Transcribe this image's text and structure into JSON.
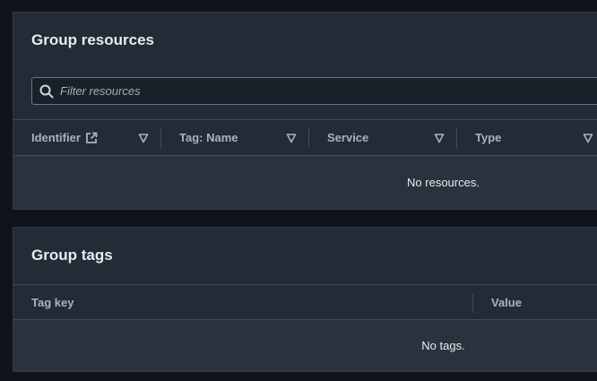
{
  "resources": {
    "title": "Group resources",
    "filter_placeholder": "Filter resources",
    "columns": [
      {
        "label": "Identifier"
      },
      {
        "label": "Tag: Name"
      },
      {
        "label": "Service"
      },
      {
        "label": "Type"
      }
    ],
    "empty_text": "No resources."
  },
  "tags": {
    "title": "Group tags",
    "columns": [
      {
        "label": "Tag key"
      },
      {
        "label": "Value"
      }
    ],
    "empty_text": "No tags."
  },
  "colors": {
    "page_bg": "#0f141a",
    "panel_bg": "#232b36",
    "text_primary": "#e9ebed",
    "text_header": "#aab3bd"
  },
  "icons": {
    "search": "search-icon",
    "external_link": "external-link-icon",
    "sort": "sort-down-icon"
  }
}
